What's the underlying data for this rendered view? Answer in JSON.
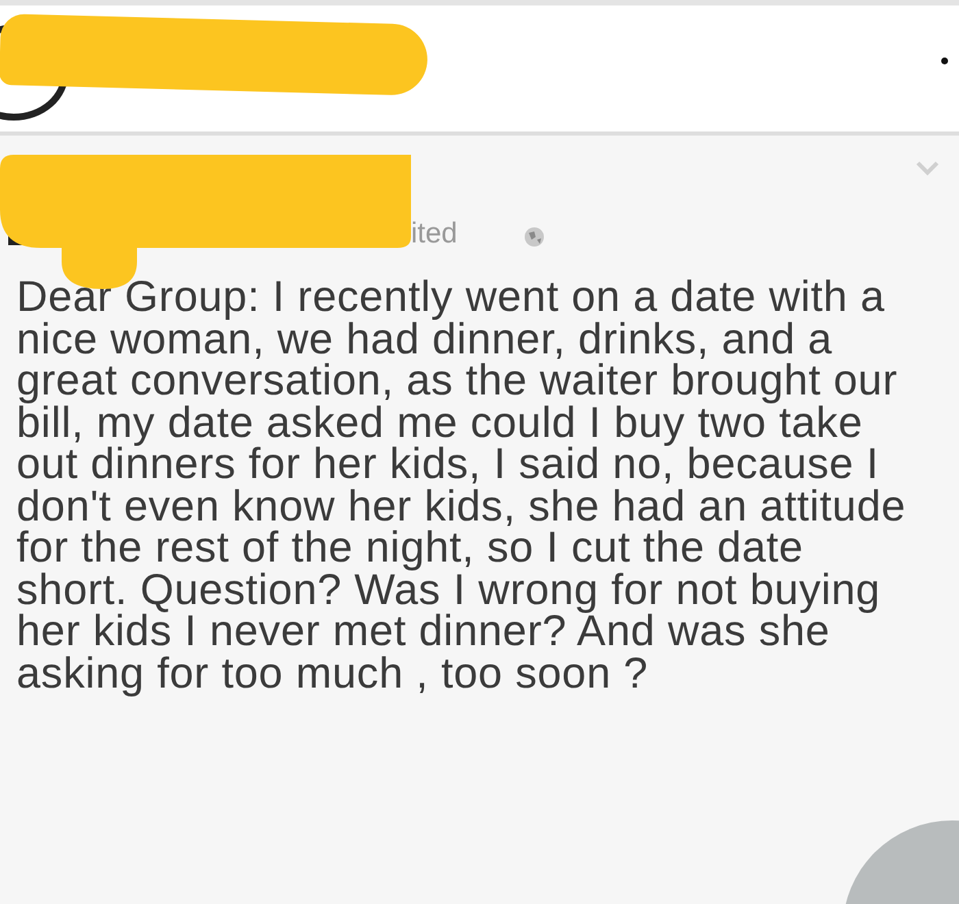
{
  "post": {
    "timestamp": "ited",
    "text_lines": [
      "Dear Group: I recently went on a date with a",
      "nice woman, we had dinner, drinks, and a",
      "great conversation, as the waiter brought our",
      "bill, my date asked me could I buy two take",
      "out dinners for her kids, I said no, because I",
      "don't even know her kids, she had an attitude",
      "for the rest of the night, so I cut the date",
      "short. Question? Was I wrong for not buying",
      "her kids I never met dinner? And was she",
      "asking for too much , too soon ?"
    ]
  }
}
